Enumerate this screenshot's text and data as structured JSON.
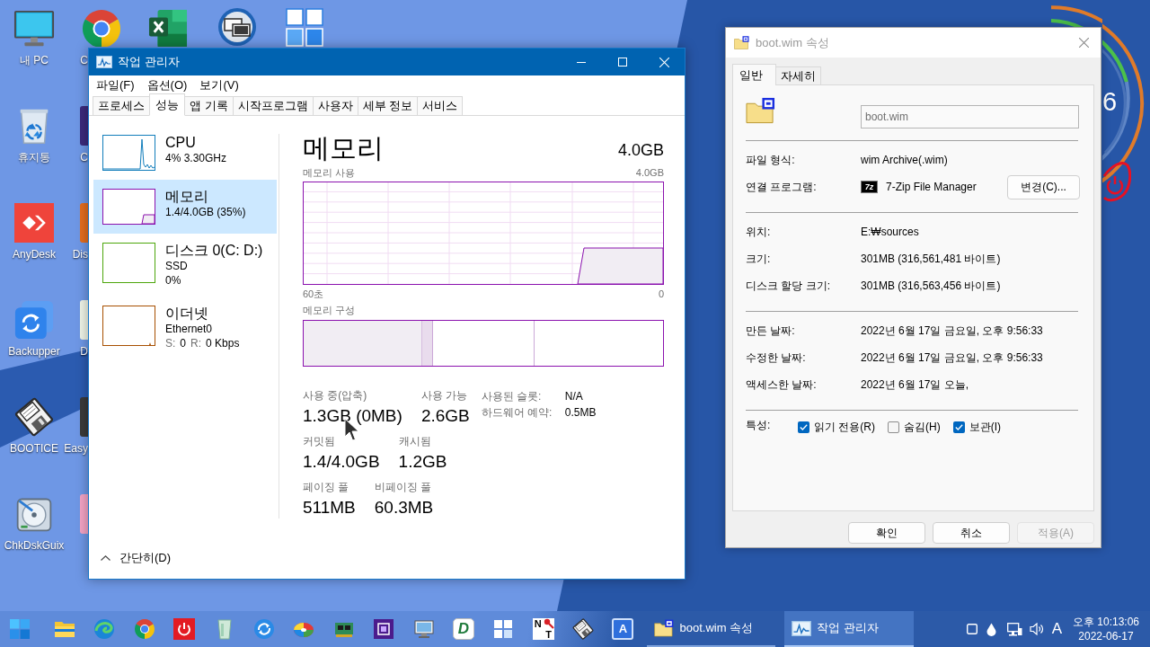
{
  "desktop": {
    "icons": [
      {
        "label": "내 PC"
      },
      {
        "label": "휴지통"
      },
      {
        "label": "AnyDesk"
      },
      {
        "label": "Backupper"
      },
      {
        "label": "BOOTICE"
      },
      {
        "label": "ChkDskGuix"
      }
    ],
    "partial_labels": [
      "C",
      "C",
      "Dis",
      "D",
      "Easy"
    ]
  },
  "gauge": {
    "reading": "6"
  },
  "task_manager": {
    "title": "작업 관리자",
    "menu": [
      "파일(F)",
      "옵션(O)",
      "보기(V)"
    ],
    "tabs": [
      {
        "label": "프로세스",
        "selected": false
      },
      {
        "label": "성능",
        "selected": true
      },
      {
        "label": "앱 기록",
        "selected": false
      },
      {
        "label": "시작프로그램",
        "selected": false
      },
      {
        "label": "사용자",
        "selected": false
      },
      {
        "label": "세부 정보",
        "selected": false
      },
      {
        "label": "서비스",
        "selected": false
      }
    ],
    "resources": [
      {
        "kind": "cpu",
        "name": "CPU",
        "lines": [
          "4% 3.30GHz"
        ],
        "color": "#117dbb",
        "selected": false
      },
      {
        "kind": "memory",
        "name": "메모리",
        "lines": [
          "1.4/4.0GB (35%)"
        ],
        "color": "#8b12ae",
        "selected": true
      },
      {
        "kind": "disk",
        "name": "디스크 0(C: D:)",
        "lines": [
          "SSD",
          "0%"
        ],
        "color": "#4da60c",
        "selected": false
      },
      {
        "kind": "network",
        "name": "이더넷",
        "lines": [
          "Ethernet0"
        ],
        "rates": [
          {
            "label": "S:",
            "value": "0"
          },
          {
            "label": "R:",
            "value": "0 Kbps"
          }
        ],
        "color": "#a74f01",
        "selected": false
      }
    ],
    "detail": {
      "title": "메모리",
      "capacity": "4.0GB",
      "usage_label": "메모리 사용",
      "usage_max": "4.0GB",
      "axis_start": "60초",
      "axis_end": "0",
      "composition_label": "메모리 구성",
      "stats": [
        [
          {
            "label": "사용 중(압축)",
            "value": "1.3GB (0MB)"
          },
          {
            "label": "사용 가능",
            "value": "2.6GB"
          }
        ],
        [
          {
            "label": "커밋됨",
            "value": "1.4/4.0GB"
          },
          {
            "label": "캐시됨",
            "value": "1.2GB"
          }
        ],
        [
          {
            "label": "페이징 풀",
            "value": "511MB"
          },
          {
            "label": "비페이징 풀",
            "value": "60.3MB"
          }
        ]
      ],
      "details": [
        {
          "label": "사용된 슬롯:",
          "value": "N/A"
        },
        {
          "label": "하드웨어 예약:",
          "value": "0.5MB"
        }
      ]
    },
    "footer": "간단히(D)"
  },
  "properties": {
    "title": "boot.wim 속성",
    "tabs": [
      {
        "label": "일반",
        "selected": true
      },
      {
        "label": "자세히",
        "selected": false
      }
    ],
    "file_name": "boot.wim",
    "sections": [
      [
        {
          "label": "파일 형식:",
          "value": "wim Archive(.wim)"
        },
        {
          "label": "연결 프로그램:",
          "value": "7-Zip File Manager",
          "icon_text": "7z",
          "button": "변경(C)..."
        }
      ],
      [
        {
          "label": "위치:",
          "value": "E:₩sources"
        },
        {
          "label": "크기:",
          "value": "301MB (316,561,481 바이트)"
        },
        {
          "label": "디스크 할당 크기:",
          "value": "301MB (316,563,456 바이트)"
        }
      ],
      [
        {
          "label": "만든 날짜:",
          "value": "2022년 6월 17일 금요일, 오후 9:56:33"
        },
        {
          "label": "수정한 날짜:",
          "value": "2022년 6월 17일 금요일, 오후 9:56:33"
        },
        {
          "label": "액세스한 날짜:",
          "value": "2022년 6월 17일 오늘,"
        }
      ]
    ],
    "attributes_label": "특성:",
    "attributes": [
      {
        "label": "읽기 전용(R)",
        "checked": true
      },
      {
        "label": "숨김(H)",
        "checked": false
      },
      {
        "label": "보관(I)",
        "checked": true
      }
    ],
    "buttons": [
      {
        "label": "확인",
        "disabled": false
      },
      {
        "label": "취소",
        "disabled": false
      },
      {
        "label": "적용(A)",
        "disabled": true
      }
    ]
  },
  "taskbar": {
    "icon_glyphs": [
      "D",
      "N",
      "T",
      "A"
    ],
    "windows": [
      {
        "label": "boot.wim 속성",
        "selected": false
      },
      {
        "label": "작업 관리자",
        "selected": true
      }
    ],
    "ime": "A",
    "time": "오후 10:13:06",
    "date": "2022-06-17"
  }
}
